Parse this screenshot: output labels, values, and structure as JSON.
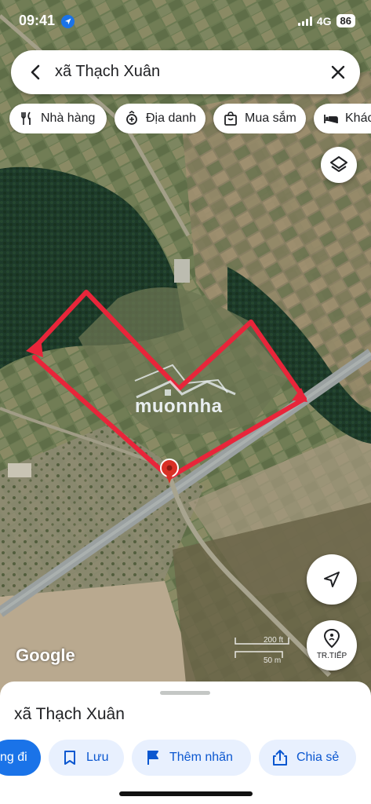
{
  "status_bar": {
    "time": "09:41",
    "network": "4G",
    "battery": "86"
  },
  "search": {
    "query": "xã Thạch Xuân"
  },
  "chips": [
    {
      "label": "Nhà hàng",
      "icon": "restaurant-icon"
    },
    {
      "label": "Địa danh",
      "icon": "landmark-icon"
    },
    {
      "label": "Mua sắm",
      "icon": "shopping-bag-icon"
    },
    {
      "label": "Khác",
      "icon": "hotel-bed-icon"
    }
  ],
  "map": {
    "attribution": "Google",
    "watermark": "muonnha",
    "scale_labels": [
      "200 ft",
      "50 m"
    ],
    "street_view_label": "TR.TIẾP",
    "boundary_color": "#e8253a",
    "pin_color": "#d93025"
  },
  "sheet": {
    "place_name": "xã Thạch Xuân",
    "actions": [
      {
        "label": "ng đi",
        "icon": "directions-icon"
      },
      {
        "label": "Lưu",
        "icon": "bookmark-icon"
      },
      {
        "label": "Thêm nhãn",
        "icon": "flag-icon"
      },
      {
        "label": "Chia sẻ",
        "icon": "share-icon"
      }
    ]
  }
}
